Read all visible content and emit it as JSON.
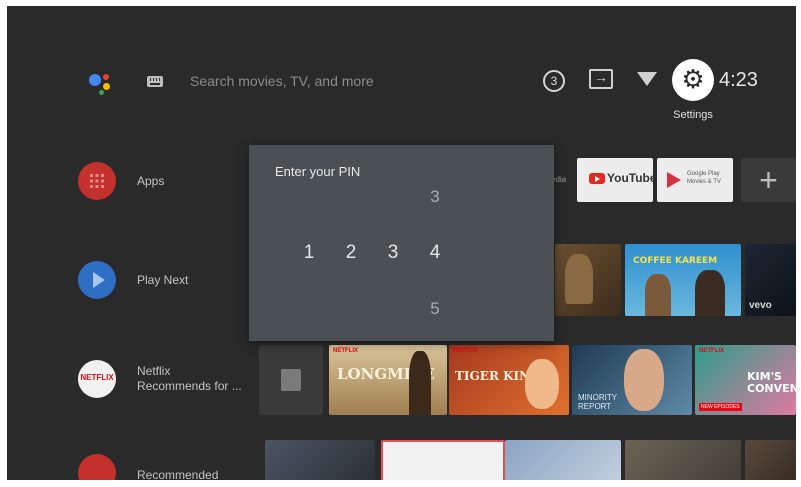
{
  "search": {
    "placeholder": "Search movies, TV, and more"
  },
  "status": {
    "notification_count": "3",
    "settings_label": "Settings",
    "time": "4:23"
  },
  "icons": {
    "assistant": "google-assistant-icon",
    "keyboard": "keyboard-icon",
    "notifications": "notification-count-icon",
    "input": "input-source-icon",
    "wifi": "wifi-icon",
    "settings": "gear-icon"
  },
  "rows": [
    {
      "label": "Apps",
      "icon": "apps-grid-icon"
    },
    {
      "label": "Play Next",
      "icon": "play-icon"
    },
    {
      "label": "Netflix",
      "sublabel": "Recommends for ...",
      "icon": "netflix-logo"
    },
    {
      "label": "Recommended",
      "icon": "youtube-icon"
    }
  ],
  "apps_row": {
    "partial_label": "edia",
    "youtube": "YouTube",
    "google_play": [
      "Google Play",
      "Movies & TV"
    ],
    "add": "+"
  },
  "play_next": {
    "coffee_title": "COFFEE KAREEM",
    "vevo": "vevo"
  },
  "netflix_row": {
    "badge": "NETFLIX",
    "titles": [
      "LONGMIRE",
      "TIGER KING",
      "MINORITY REPORT",
      "KIM'S CONVENIENCE"
    ],
    "new_episodes": "NEW EPISODES"
  },
  "pin_dialog": {
    "title": "Enter your PIN",
    "digits": [
      "1",
      "2",
      "3",
      "4"
    ],
    "above": "3",
    "below": "5"
  },
  "colors": {
    "background": "#2a2a2b",
    "dialog": "#4a5054",
    "apps_icon": "#c4302b",
    "play_next_icon": "#2e6ec4",
    "netflix_red": "#e50914"
  }
}
